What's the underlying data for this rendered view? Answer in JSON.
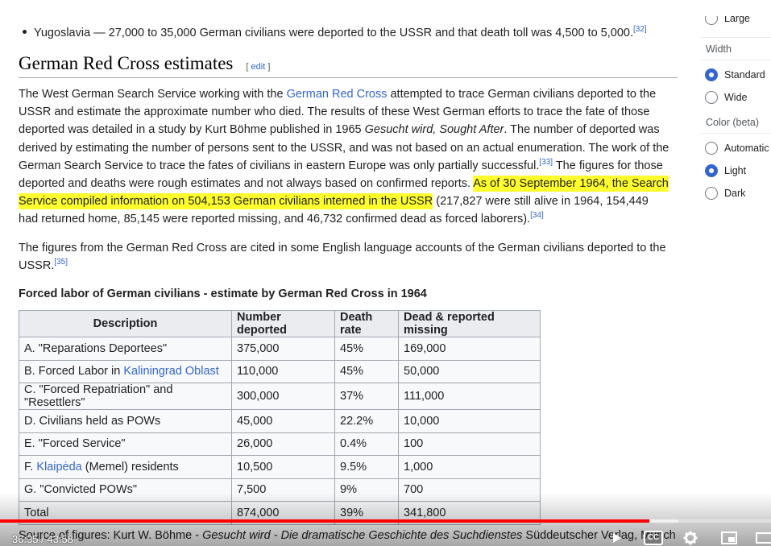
{
  "article": {
    "bullet": {
      "text": "Yugoslavia — 27,000 to 35,000 German civilians were deported to the USSR and that death toll was 4,500 to 5,000.",
      "ref": "[32]"
    },
    "heading": {
      "title": "German Red Cross estimates",
      "edit_open": "[ ",
      "edit_label": "edit",
      "edit_close": " ]"
    },
    "p1": {
      "t1": "The West German Search Service working with the ",
      "link1": "German Red Cross",
      "t2": " attempted to trace German civilians deported to the USSR and estimate the approximate number who died. The results of these West German efforts to trace the fate of those deported was detailed in a study by Kurt Böhme published in 1965 ",
      "em1": "Gesucht wird, Sought After",
      "t3": ". The number of deported was derived by estimating the number of persons sent to the USSR, and was not based on an actual enumeration. The work of the German Search Service to trace the fates of civilians in eastern Europe was only partially successful.",
      "ref1": "[33]",
      "t4": " The figures for those deported and deaths were rough estimates and not always based on confirmed reports. ",
      "highlight": "As of 30 September 1964, the Search Service compiled information on 504,153 German civilians interned in the USSR",
      "t5": " (217,827 were still alive in 1964, 154,449 had returned home, 85,145 were reported missing, and 46,732 confirmed dead as forced laborers).",
      "ref2": "[34]"
    },
    "p2": {
      "text": "The figures from the German Red Cross are cited in some English language accounts of the German civilians deported to the USSR.",
      "ref": "[35]"
    },
    "table": {
      "caption": "Forced labor of German civilians - estimate by German Red Cross in 1964",
      "headers": [
        "Description",
        "Number deported",
        "Death rate",
        "Dead & reported missing"
      ],
      "rows": [
        {
          "pre": "A. \"Reparations Deportees\"",
          "link": "",
          "post": "",
          "num": "375,000",
          "rate": "45%",
          "dead": "169,000"
        },
        {
          "pre": "B. Forced Labor in ",
          "link": "Kaliningrad Oblast",
          "post": "",
          "num": "110,000",
          "rate": "45%",
          "dead": "50,000"
        },
        {
          "pre": "C. \"Forced Repatriation\" and \"Resettlers\"",
          "link": "",
          "post": "",
          "num": "300,000",
          "rate": "37%",
          "dead": "111,000"
        },
        {
          "pre": "D. Civilians held as POWs",
          "link": "",
          "post": "",
          "num": "45,000",
          "rate": "22.2%",
          "dead": "10,000"
        },
        {
          "pre": "E. \"Forced Service\"",
          "link": "",
          "post": "",
          "num": "26,000",
          "rate": "0.4%",
          "dead": "100"
        },
        {
          "pre": "F. ",
          "link": "Klaipėda",
          "post": " (Memel) residents",
          "num": "10,500",
          "rate": "9.5%",
          "dead": "1,000"
        },
        {
          "pre": "G. \"Convicted POWs\"",
          "link": "",
          "post": "",
          "num": "7,500",
          "rate": "9%",
          "dead": "700"
        },
        {
          "pre": "Total",
          "link": "",
          "post": "",
          "num": "874,000",
          "rate": "39%",
          "dead": "341,800"
        }
      ]
    },
    "source": {
      "t1": "Source of figures: Kurt W. Böhme - ",
      "em": "Gesucht wird - Die dramatische Geschichte des Suchdienstes",
      "t2": " Süddeutscher Verlag, Münch"
    }
  },
  "sidebar": {
    "partial_top": "Large",
    "width_label": "Width",
    "width_options": [
      {
        "label": "Standard",
        "checked": true
      },
      {
        "label": "Wide",
        "checked": false
      }
    ],
    "color_label": "Color (beta)",
    "color_options": [
      {
        "label": "Automatic",
        "checked": false
      },
      {
        "label": "Light",
        "checked": true
      },
      {
        "label": "Dark",
        "checked": false
      }
    ]
  },
  "player": {
    "time": "36:35 / 43:58",
    "progress": 0.8417,
    "buffered": 0.88,
    "accent_color": "#ff0000",
    "icons": [
      "play-icon",
      "cc-icon",
      "settings-gear-icon",
      "miniplayer-icon",
      "theater-icon"
    ]
  }
}
